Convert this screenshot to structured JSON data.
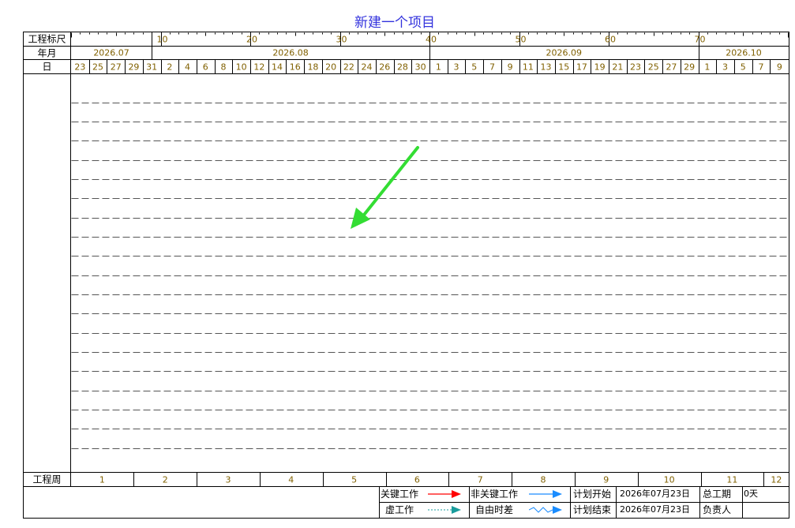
{
  "title": "新建一个项目",
  "row_headers": {
    "scale": "工程标尺",
    "month": "年月",
    "day": "日",
    "week": "工程周"
  },
  "scale_labels": [
    "10",
    "20",
    "30",
    "40",
    "50",
    "60",
    "70"
  ],
  "months": [
    "2026.07",
    "2026.08",
    "2026.09",
    "2026.10"
  ],
  "days": [
    "23",
    "25",
    "27",
    "29",
    "31",
    "2",
    "4",
    "6",
    "8",
    "10",
    "12",
    "14",
    "16",
    "18",
    "20",
    "22",
    "24",
    "26",
    "28",
    "30",
    "1",
    "3",
    "5",
    "7",
    "9",
    "11",
    "13",
    "15",
    "17",
    "19",
    "21",
    "23",
    "25",
    "27",
    "29",
    "1",
    "3",
    "5",
    "7",
    "9"
  ],
  "weeks": [
    "1",
    "2",
    "3",
    "4",
    "5",
    "6",
    "7",
    "8",
    "9",
    "10",
    "11",
    "12"
  ],
  "legend": {
    "critical": "关键工作",
    "non_critical": "非关键工作",
    "dummy": "虚工作",
    "free_float": "自由时差",
    "plan_start_label": "计划开始",
    "plan_start_value": "2026年07月23日",
    "plan_end_label": "计划结束",
    "plan_end_value": "2026年07月23日",
    "duration_label": "总工期",
    "duration_value": "0天",
    "owner_label": "负责人",
    "owner_value": ""
  },
  "colors": {
    "title": "#3333dd",
    "header_text": "#806000",
    "critical": "#ff0000",
    "non_critical": "#1a8cff",
    "dummy": "#1a9c9c",
    "annotation_arrow": "#33dd33"
  },
  "annotation": "green-arrow"
}
